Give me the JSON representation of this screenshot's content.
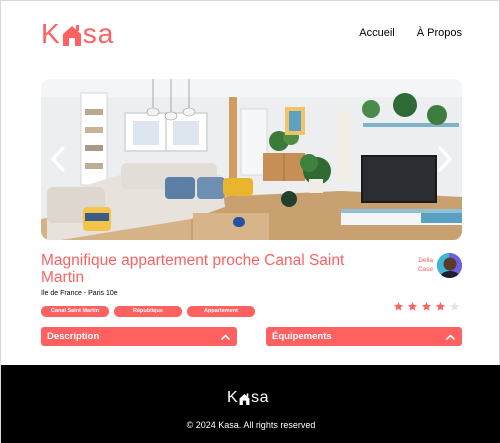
{
  "header": {
    "logo_left": "K",
    "logo_right": "sa",
    "nav": [
      {
        "label": "Accueil"
      },
      {
        "label": "À Propos"
      }
    ]
  },
  "listing": {
    "title": "Magnifique appartement proche Canal Saint Martin",
    "location": "Ile de France - Paris 10e",
    "tags": [
      "Canal Saint Martin",
      "République",
      "Appartement"
    ],
    "host": {
      "name_line1": "Della",
      "name_line2": "Case"
    },
    "rating": 4,
    "rating_max": 5
  },
  "collapses": [
    {
      "title": "Description"
    },
    {
      "title": "Équipements"
    }
  ],
  "footer": {
    "logo_left": "K",
    "logo_right": "sa",
    "copyright": "© 2024 Kasa. All rights reserved"
  },
  "colors": {
    "brand": "#ff6060",
    "star_on": "#ff6060",
    "star_off": "#e3e3e3",
    "footer_bg": "#000000"
  },
  "icons": {
    "prev": "chevron-left-icon",
    "next": "chevron-right-icon",
    "collapse": "chevron-up-icon",
    "star": "star-icon"
  }
}
